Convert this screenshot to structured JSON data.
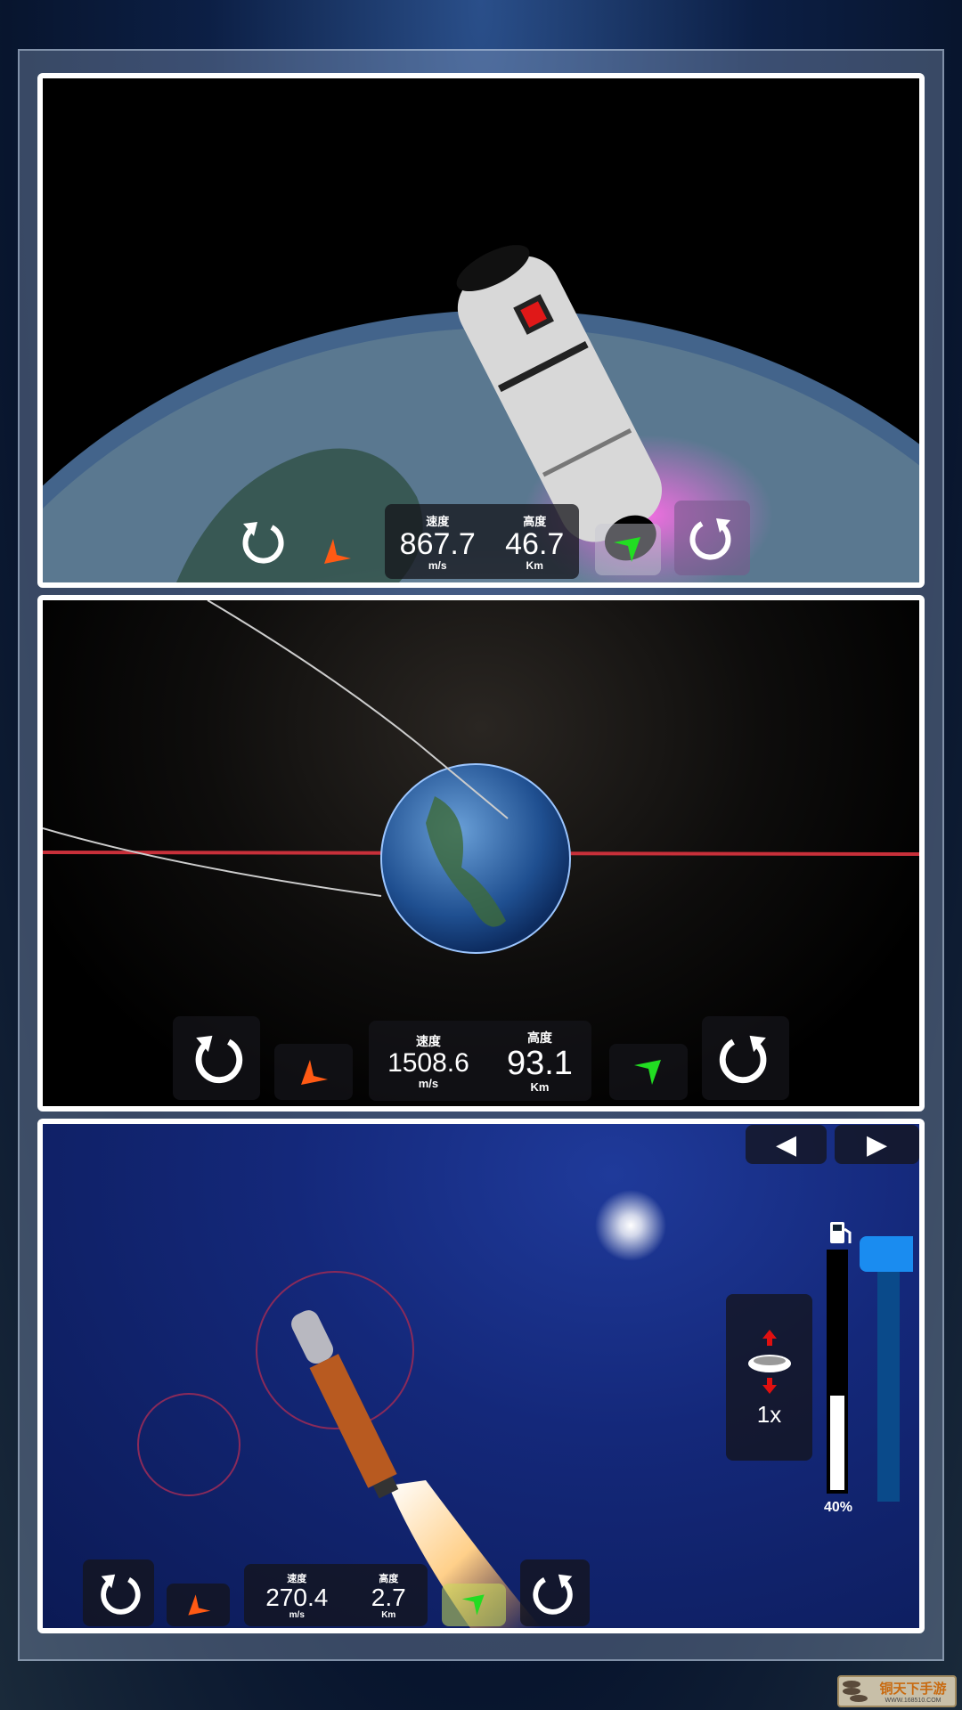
{
  "panels": [
    {
      "speed_label": "速度",
      "speed": "867.7",
      "speed_unit": "m/s",
      "alt_label": "高度",
      "alt": "46.7",
      "alt_unit": "Km"
    },
    {
      "speed_label": "速度",
      "speed": "1508.6",
      "speed_unit": "m/s",
      "alt_label": "高度",
      "alt": "93.1",
      "alt_unit": "Km"
    },
    {
      "speed_label": "速度",
      "speed": "270.4",
      "speed_unit": "m/s",
      "alt_label": "高度",
      "alt": "2.7",
      "alt_unit": "Km"
    }
  ],
  "controls": {
    "prev": "◀",
    "next": "▶",
    "throttle_multiplier": "1x",
    "fuel_percent": 40,
    "fuel_label": "40%"
  },
  "icons": {
    "rotate_left": "rotate-ccw-icon",
    "rotate_right": "rotate-cw-icon",
    "turn_left": "orange-arrow-icon",
    "turn_right": "green-arrow-icon",
    "fuel": "fuel-pump-icon"
  },
  "colors": {
    "orange_arrow": "#ff5a14",
    "green_arrow": "#22dd22",
    "slider": "#1a8cf0",
    "red_line": "#c8303a"
  },
  "watermark": {
    "brand": "铜天下手游",
    "url": "WWW.168510.COM"
  }
}
